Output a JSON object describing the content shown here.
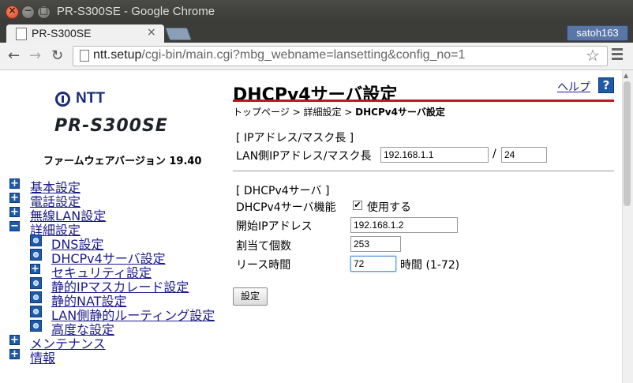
{
  "window": {
    "title": "PR-S300SE - Google Chrome"
  },
  "tab": {
    "title": "PR-S300SE",
    "close": "×"
  },
  "profile": {
    "name": "satoh163"
  },
  "toolbar": {
    "url_host": "ntt.setup",
    "url_path": "/cgi-bin/main.cgi?mbg_webname=lansetting&config_no=1",
    "back_icon": "←",
    "forward_icon": "→",
    "reload_icon": "↻",
    "star_icon": "☆"
  },
  "brand": {
    "company": "NTT",
    "product": "PR-S300SE",
    "firmware": "ファームウェアバージョン 19.40"
  },
  "menu": {
    "items": [
      {
        "label": "基本設定",
        "icon": "+"
      },
      {
        "label": "電話設定",
        "icon": "+"
      },
      {
        "label": "無線LAN設定",
        "icon": "+"
      },
      {
        "label": "詳細設定",
        "icon": "−"
      },
      {
        "label": "メンテナンス",
        "icon": "+"
      },
      {
        "label": "情報",
        "icon": "+"
      }
    ],
    "subitems": [
      {
        "label": "DNS設定"
      },
      {
        "label": "DHCPv4サーバ設定"
      },
      {
        "label": "セキュリティ設定",
        "icon": "+"
      },
      {
        "label": "静的IPマスカレード設定"
      },
      {
        "label": "静的NAT設定"
      },
      {
        "label": "LAN側静的ルーティング設定"
      },
      {
        "label": "高度な設定"
      }
    ]
  },
  "page": {
    "title": "DHCPv4サーバ設定",
    "help": "ヘルプ",
    "help_icon": "?",
    "breadcrumb": {
      "home": "トップページ",
      "sep": " > ",
      "parent": "詳細設定",
      "current": "DHCPv4サーバ設定"
    }
  },
  "ip_section": {
    "heading": "[ IPアドレス/マスク長 ]",
    "lan_label": "LAN側IPアドレス/マスク長",
    "ip_value": "192.168.1.1",
    "slash": "/",
    "mask_value": "24"
  },
  "dhcp_section": {
    "heading": "[ DHCPv4サーバ ]",
    "function_label": "DHCPv4サーバ機能",
    "use_label": "使用する",
    "use_checked": true,
    "start_label": "開始IPアドレス",
    "start_value": "192.168.1.2",
    "count_label": "割当て個数",
    "count_value": "253",
    "lease_label": "リース時間",
    "lease_value": "72",
    "lease_unit": "時間 (1-72)"
  },
  "submit": {
    "label": "設定"
  }
}
